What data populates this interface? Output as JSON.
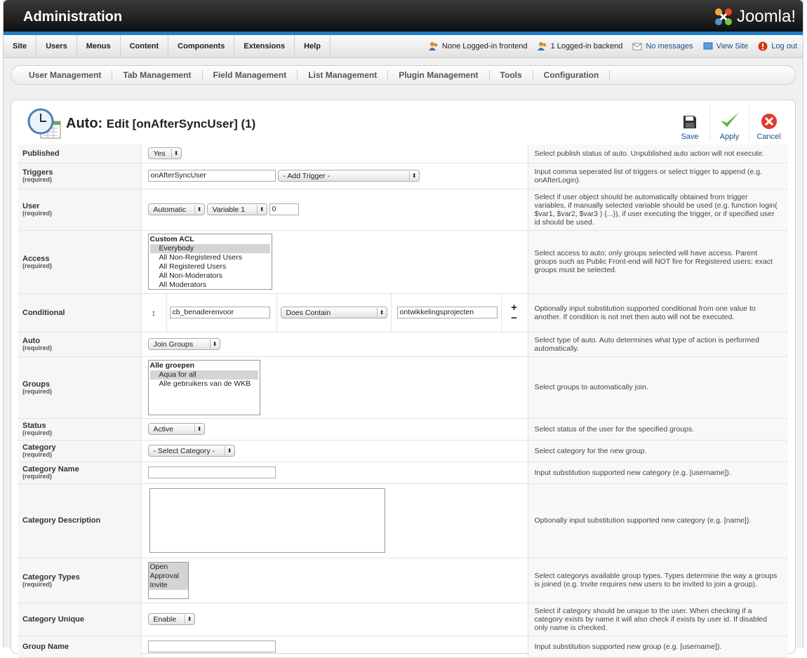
{
  "header": {
    "title": "Administration",
    "logo_text": "Joomla!"
  },
  "menu": [
    "Site",
    "Users",
    "Menus",
    "Content",
    "Components",
    "Extensions",
    "Help"
  ],
  "status": {
    "frontend": "None Logged-in frontend",
    "backend": "1 Logged-in backend",
    "messages": "No messages",
    "view_site": "View Site",
    "logout": "Log out"
  },
  "subnav": [
    "User Management",
    "Tab Management",
    "Field Management",
    "List Management",
    "Plugin Management",
    "Tools",
    "Configuration"
  ],
  "page": {
    "prefix": "Auto:",
    "title": "Edit [onAfterSyncUser] (1)"
  },
  "toolbar": {
    "save": "Save",
    "apply": "Apply",
    "cancel": "Cancel"
  },
  "required_label": "(required)",
  "fields": {
    "published": {
      "label": "Published",
      "value": "Yes",
      "desc": "Select publish status of auto. Unpublished auto action will not execute."
    },
    "triggers": {
      "label": "Triggers",
      "value": "onAfterSyncUser",
      "select": "- Add Trigger -",
      "desc": "Input comma seperated list of triggers or select trigger to append (e.g. onAfterLogin)."
    },
    "user": {
      "label": "User",
      "mode": "Automatic",
      "variable": "Variable 1",
      "id": "0",
      "desc": "Select if user object should be automatically obtained from trigger variables, if manually selected variable should be used (e.g. function login( $var1, $var2, $var3 ) {...}), if user executing the trigger, or if specified user id should be used."
    },
    "access": {
      "label": "Access",
      "group": "Custom ACL",
      "options": [
        "Everybody",
        "All Non-Registered Users",
        "All Registered Users",
        "All Non-Moderators",
        "All Moderators"
      ],
      "desc": "Select access to auto; only groups selected will have access. Parent groups such as Public Front-end will NOT fire for Registered users; exact groups must be selected."
    },
    "conditional": {
      "label": "Conditional",
      "arrows": "↕",
      "field": "cb_benaderenvoor",
      "operator": "Does Contain",
      "value": "ontwikkelingsprojecten",
      "plus": "+",
      "minus": "−",
      "desc": "Optionally input substitution supported conditional from one value to another. If condition is not met then auto will not be executed."
    },
    "auto": {
      "label": "Auto",
      "value": "Join Groups",
      "desc": "Select type of auto. Auto determines what type of action is performed automatically."
    },
    "groups": {
      "label": "Groups",
      "group": "Alle groepen",
      "options": [
        "Aqua for all",
        "Alle gebruikers van de WKB"
      ],
      "desc": "Select groups to automatically join."
    },
    "status": {
      "label": "Status",
      "value": "Active",
      "desc": "Select status of the user for the specified groups."
    },
    "category": {
      "label": "Category",
      "value": "- Select Category -",
      "desc": "Select category for the new group."
    },
    "category_name": {
      "label": "Category Name",
      "value": "",
      "desc": "Input substitution supported new category (e.g. [username])."
    },
    "category_description": {
      "label": "Category Description",
      "desc": "Optionally input substitution supported new category (e.g. [name])."
    },
    "category_types": {
      "label": "Category Types",
      "options": [
        "Open",
        "Approval",
        "Invite"
      ],
      "desc": "Select categorys available group types. Types determine the way a groups is joined (e.g. Invite requires new users to be invited to join a group)."
    },
    "category_unique": {
      "label": "Category Unique",
      "value": "Enable",
      "desc": "Select if category should be unique to the user. When checking if a category exists by name it will also check if exists by user id. If disabled only name is checked."
    },
    "group_name": {
      "label": "Group Name",
      "desc": "Input substitution supported new group (e.g. [username])."
    }
  },
  "colors": {
    "header_bar": "#1e7ec7",
    "link": "#1b4f8a"
  }
}
